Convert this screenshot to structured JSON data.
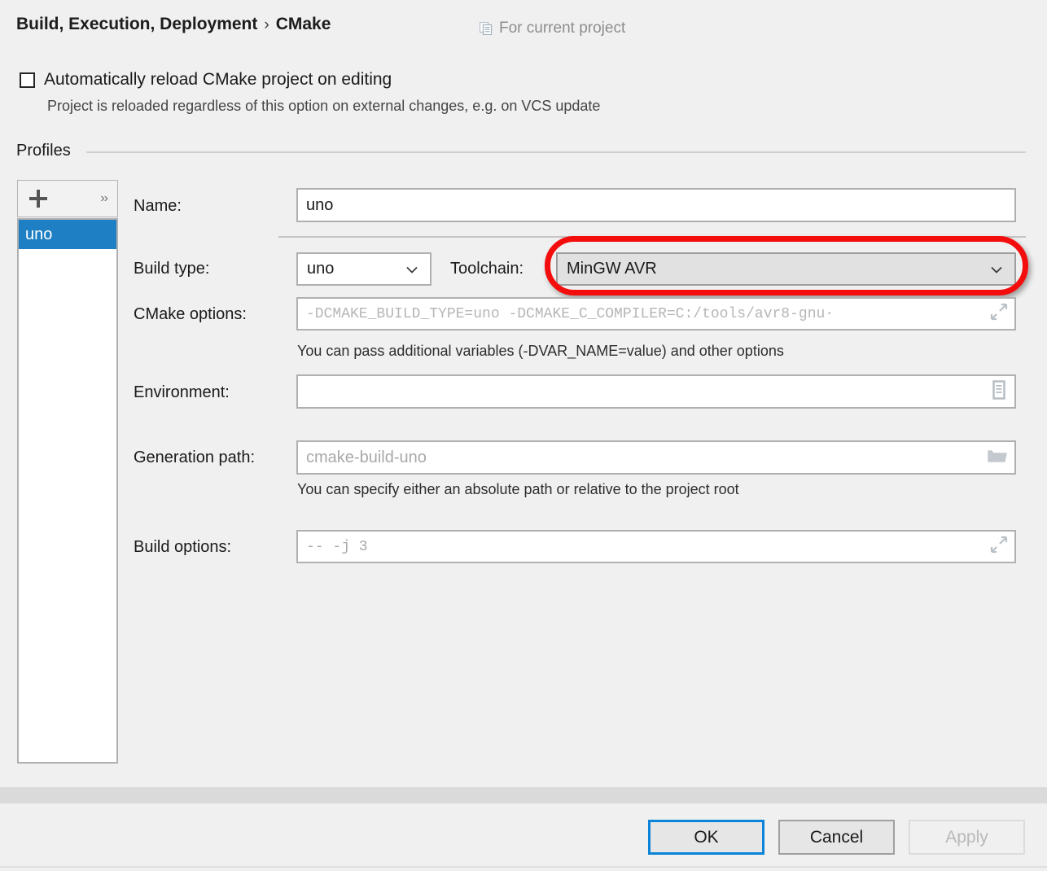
{
  "header": {
    "breadcrumb_root": "Build, Execution, Deployment",
    "breadcrumb_separator": "›",
    "breadcrumb_leaf": "CMake",
    "scope_label": "For current project",
    "scope_icon": "copy-pages-icon"
  },
  "auto_reload": {
    "label": "Automatically reload CMake project on editing",
    "checked": false,
    "hint": "Project is reloaded regardless of this option on external changes, e.g. on VCS update"
  },
  "profiles": {
    "group_title": "Profiles",
    "toolbar": {
      "add_icon": "plus-icon",
      "add_tooltip": "Add profile",
      "more_label": "››",
      "more_icon": "chevron-double-right-icon"
    },
    "items": [
      {
        "name": "uno",
        "selected": true
      }
    ]
  },
  "form": {
    "name": {
      "label": "Name:",
      "value": "uno"
    },
    "build_type": {
      "label": "Build type:",
      "value": "uno",
      "chevron_icon": "chevron-down-icon"
    },
    "toolchain": {
      "label": "Toolchain:",
      "value": "MinGW AVR",
      "chevron_icon": "chevron-down-icon",
      "highlighted": true
    },
    "cmake_options": {
      "label": "CMake options:",
      "placeholder": "-DCMAKE_BUILD_TYPE=uno  -DCMAKE_C_COMPILER=C:/tools/avr8-gnu·",
      "expand_icon": "expand-diagonal-icon",
      "hint": "You can pass additional variables (-DVAR_NAME=value) and other options"
    },
    "environment": {
      "label": "Environment:",
      "value": "",
      "editor_icon": "document-list-icon"
    },
    "generation_path": {
      "label": "Generation path:",
      "placeholder": "cmake-build-uno",
      "browse_icon": "folder-icon",
      "hint": "You can specify either an absolute path or relative to the project root"
    },
    "build_options": {
      "label": "Build options:",
      "placeholder": "--  -j  3",
      "expand_icon": "expand-diagonal-icon"
    }
  },
  "annotation": {
    "shape": "rounded-rectangle-highlight",
    "target": "toolchain-combobox",
    "color": "#f30d0d"
  },
  "footer": {
    "ok_label": "OK",
    "cancel_label": "Cancel",
    "apply_label": "Apply",
    "apply_enabled": false
  },
  "colors": {
    "window_background": "#f0f0f0",
    "selection_blue": "#1e7fc4",
    "focus_blue": "#0a84d8",
    "annotation_red": "#f30d0d",
    "combo_fill": "#e1e1e1",
    "scrollbar_track": "#dadada"
  }
}
